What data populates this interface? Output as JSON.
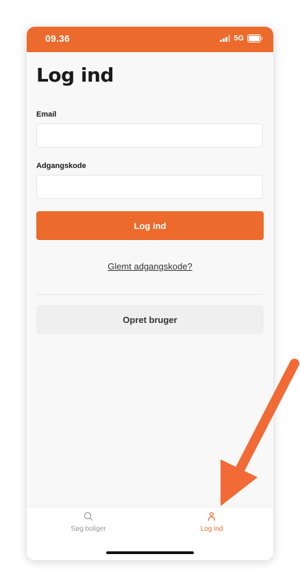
{
  "status_bar": {
    "time": "09.36",
    "network": "5G"
  },
  "page": {
    "title": "Log ind"
  },
  "form": {
    "email_label": "Email",
    "email_value": "",
    "password_label": "Adgangskode",
    "password_value": "",
    "submit_label": "Log ind",
    "forgot_password_label": "Glemt adgangskode?",
    "create_user_label": "Opret bruger"
  },
  "tab_bar": {
    "items": [
      {
        "label": "Søg boliger",
        "icon": "search-icon",
        "active": false
      },
      {
        "label": "Log ind",
        "icon": "person-icon",
        "active": true
      }
    ]
  },
  "colors": {
    "accent": "#ec6a2c",
    "annotation_arrow": "#f26a35"
  }
}
